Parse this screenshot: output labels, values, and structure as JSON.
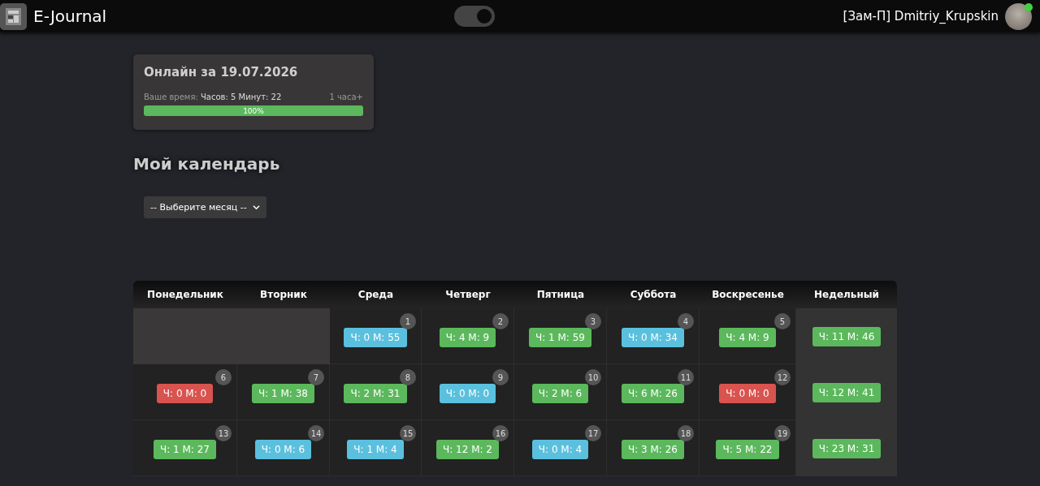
{
  "header": {
    "app_name": "E-Journal",
    "theme_toggle": {
      "on": true
    },
    "user": {
      "name": "[Зам-П] Dmitriy_Krupskin",
      "online": true
    }
  },
  "online_card": {
    "title": "Онлайн за 19.07.2026",
    "time_label": "Ваше время:",
    "time_value": "Часов: 5 Минут: 22",
    "goal": "1 часа+",
    "progress": {
      "level": 1,
      "label": "100%"
    }
  },
  "calendar": {
    "title": "Мой календарь",
    "month_select": {
      "value": "-- Выберите месяц --"
    },
    "columns": [
      "Понедельник",
      "Вторник",
      "Среда",
      "Четверг",
      "Пятница",
      "Суббота",
      "Воскресенье",
      "Недельный"
    ],
    "weeks": [
      {
        "days": [
          {
            "kind": "blank"
          },
          {
            "kind": "blank"
          },
          {
            "kind": "day",
            "number": "1",
            "time": "Ч: 0 М: 55",
            "color": "#5bc0de"
          },
          {
            "kind": "day",
            "number": "2",
            "time": "Ч: 4 М: 9",
            "color": "#5cb85c"
          },
          {
            "kind": "day",
            "number": "3",
            "time": "Ч: 1 М: 59",
            "color": "#5cb85c"
          },
          {
            "kind": "day",
            "number": "4",
            "time": "Ч: 0 М: 34",
            "color": "#5bc0de"
          },
          {
            "kind": "day",
            "number": "5",
            "time": "Ч: 4 М: 9",
            "color": "#5cb85c"
          }
        ],
        "total": "Ч: 11 М: 46"
      },
      {
        "days": [
          {
            "kind": "day",
            "number": "6",
            "time": "Ч: 0 М: 0",
            "color": "#d9534f"
          },
          {
            "kind": "day",
            "number": "7",
            "time": "Ч: 1 М: 38",
            "color": "#5cb85c"
          },
          {
            "kind": "day",
            "number": "8",
            "time": "Ч: 2 М: 31",
            "color": "#5cb85c"
          },
          {
            "kind": "day",
            "number": "9",
            "time": "Ч: 0 М: 0",
            "color": "#5bc0de"
          },
          {
            "kind": "day",
            "number": "10",
            "time": "Ч: 2 М: 6",
            "color": "#5cb85c"
          },
          {
            "kind": "day",
            "number": "11",
            "time": "Ч: 6 М: 26",
            "color": "#5cb85c"
          },
          {
            "kind": "day",
            "number": "12",
            "time": "Ч: 0 М: 0",
            "color": "#d9534f"
          }
        ],
        "total": "Ч: 12 М: 41"
      },
      {
        "days": [
          {
            "kind": "day",
            "number": "13",
            "time": "Ч: 1 М: 27",
            "color": "#5cb85c"
          },
          {
            "kind": "day",
            "number": "14",
            "time": "Ч: 0 М: 6",
            "color": "#5bc0de"
          },
          {
            "kind": "day",
            "number": "15",
            "time": "Ч: 1 М: 4",
            "color": "#5bc0de"
          },
          {
            "kind": "day",
            "number": "16",
            "time": "Ч: 12 М: 2",
            "color": "#5cb85c"
          },
          {
            "kind": "day",
            "number": "17",
            "time": "Ч: 0 М: 4",
            "color": "#5bc0de"
          },
          {
            "kind": "day",
            "number": "18",
            "time": "Ч: 3 М: 26",
            "color": "#5cb85c"
          },
          {
            "kind": "day",
            "number": "19",
            "time": "Ч: 5 М: 22",
            "color": "#5cb85c"
          }
        ],
        "total": "Ч: 23 М: 31"
      }
    ]
  }
}
